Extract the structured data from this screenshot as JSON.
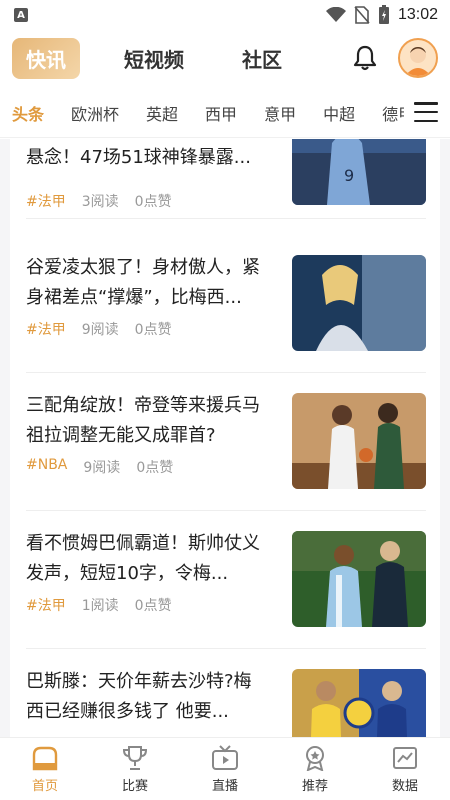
{
  "status_bar": {
    "time": "13:02",
    "app_badge": "A"
  },
  "top_tabs": [
    {
      "label": "快讯",
      "active": true
    },
    {
      "label": "短视频",
      "active": false
    },
    {
      "label": "社区",
      "active": false
    }
  ],
  "channels": [
    {
      "label": "头条",
      "active": true
    },
    {
      "label": "欧洲杯"
    },
    {
      "label": "英超"
    },
    {
      "label": "西甲"
    },
    {
      "label": "意甲"
    },
    {
      "label": "中超"
    },
    {
      "label": "德甲"
    }
  ],
  "feed": [
    {
      "title": "悬念！47场51球神锋暴露...",
      "tag": "#法甲",
      "reads": "3阅读",
      "likes": "0点赞",
      "thumb_colors": [
        "#3a5a8a",
        "#7fa6d6"
      ]
    },
    {
      "title": "谷爱凌太狠了！身材傲人，紧身裙差点“撑爆”，比梅西...",
      "tag": "#法甲",
      "reads": "9阅读",
      "likes": "0点赞",
      "thumb_colors": [
        "#1d3a5c",
        "#8aa9c9"
      ]
    },
    {
      "title": "三配角绽放！帝登等来援兵马祖拉调整无能又成罪首?",
      "tag": "#NBA",
      "reads": "9阅读",
      "likes": "0点赞",
      "thumb_colors": [
        "#7a4f2c",
        "#c79a6a"
      ]
    },
    {
      "title": "看不惯姆巴佩霸道！斯帅仗义发声，短短10字，令梅...",
      "tag": "#法甲",
      "reads": "1阅读",
      "likes": "0点赞",
      "thumb_colors": [
        "#2e5e2a",
        "#9cc7e6"
      ]
    },
    {
      "title": "巴斯滕：天价年薪去沙特?梅西已经赚很多钱了 他要...",
      "tag": "",
      "reads": "",
      "likes": "",
      "thumb_colors": [
        "#c9a04a",
        "#2a4fa0"
      ]
    }
  ],
  "bottom_nav": [
    {
      "label": "首页",
      "icon": "home-icon",
      "active": true
    },
    {
      "label": "比赛",
      "icon": "trophy-icon"
    },
    {
      "label": "直播",
      "icon": "tv-icon"
    },
    {
      "label": "推荐",
      "icon": "medal-icon"
    },
    {
      "label": "数据",
      "icon": "chart-icon"
    }
  ],
  "colors": {
    "accent": "#e09a3e",
    "tab_gradient_start": "#e6b778",
    "tab_gradient_end": "#f4d6a9"
  }
}
